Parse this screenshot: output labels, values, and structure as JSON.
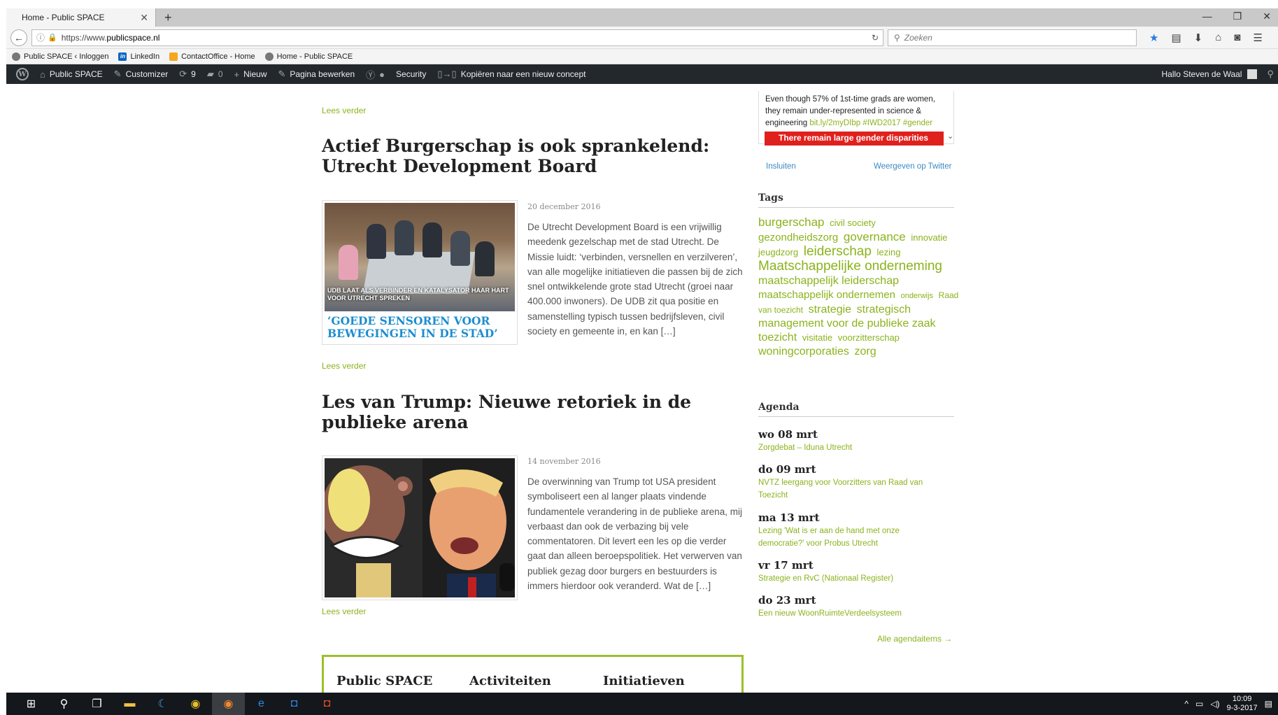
{
  "browser": {
    "tab_title": "Home - Public SPACE",
    "url_prefix": "https://www.",
    "url_host": "publicspace.nl",
    "search_placeholder": "Zoeken",
    "bookmarks": [
      "Public SPACE ‹ Inloggen",
      "LinkedIn",
      "ContactOffice - Home",
      "Home - Public SPACE"
    ]
  },
  "wpbar": {
    "site": "Public SPACE",
    "customizer": "Customizer",
    "updates": "9",
    "comments": "0",
    "new": "Nieuw",
    "edit": "Pagina bewerken",
    "security": "Security",
    "copy": "Kopiëren naar een nieuw concept",
    "greeting": "Hallo Steven de Waal"
  },
  "posts": [
    {
      "title": "Actief Burgerschap is ook sprankelend: Utrecht Development Board",
      "date": "20 december 2016",
      "excerpt": "De Utrecht Development Board is een vrijwillig meedenk gezelschap met de stad Utrecht. De Missie luidt: ‘verbinden, versnellen en verzilveren’, van alle mogelijke initiatieven die passen bij de zich snel ontwikkelende grote stad Utrecht (groei naar 400.000 inwoners). De UDB zit qua positie en samenstelling typisch tussen bedrijfsleven, civil society en gemeente in, en kan […]",
      "image_caption": "UDB LAAT ALS VERBINDER EN KATALYSATOR HAAR HART VOOR UTRECHT SPREKEN",
      "image_quote": "‘GOEDE SENSOREN VOOR BEWEGINGEN IN DE STAD’"
    },
    {
      "title": "Les van Trump: Nieuwe retoriek in de publieke arena",
      "date": "14 november 2016",
      "excerpt": "De overwinning van Trump tot USA president symboliseert een al langer plaats vindende fundamentele verandering in de publieke arena, mij verbaast dan ook de verbazing bij vele commentatoren. Dit levert een les op die verder gaat dan alleen beroepspolitiek. Het verwerven van publiek gezag door burgers en bestuurders is immers hierdoor ook veranderd. Wat de […]"
    }
  ],
  "read_more": "Lees verder",
  "footer": {
    "cols": [
      "Public SPACE",
      "Activiteiten",
      "Initiatieven"
    ]
  },
  "sidebar": {
    "tweet": {
      "text": "Even though 57% of 1st-time grads are women, they remain under-represented in science & engineering",
      "links": "bit.ly/2myDIbp #IWD2017 #gender",
      "banner": "There remain large gender disparities",
      "embed": "Insluiten",
      "view": "Weergeven op Twitter"
    },
    "tags_title": "Tags",
    "tags": [
      {
        "t": "burgerschap",
        "s": 17
      },
      {
        "t": "civil society",
        "s": 13
      },
      {
        "t": "gezondheidszorg",
        "s": 15
      },
      {
        "t": "governance",
        "s": 17
      },
      {
        "t": "innovatie",
        "s": 13
      },
      {
        "t": "jeugdzorg",
        "s": 13
      },
      {
        "t": "leiderschap",
        "s": 19
      },
      {
        "t": "lezing",
        "s": 13
      },
      {
        "t": "Maatschappelijke onderneming",
        "s": 19
      },
      {
        "t": "maatschappelijk leiderschap",
        "s": 16
      },
      {
        "t": "maatschappelijk ondernemen",
        "s": 15
      },
      {
        "t": "onderwijs",
        "s": 11
      },
      {
        "t": "Raad van toezicht",
        "s": 12
      },
      {
        "t": "strategie",
        "s": 16
      },
      {
        "t": "strategisch management voor de publieke zaak",
        "s": 16
      },
      {
        "t": "toezicht",
        "s": 16
      },
      {
        "t": "visitatie",
        "s": 13
      },
      {
        "t": "voorzitterschap",
        "s": 13
      },
      {
        "t": "woningcorporaties",
        "s": 16
      },
      {
        "t": "zorg",
        "s": 16
      }
    ],
    "agenda_title": "Agenda",
    "agenda": [
      {
        "date": "wo 08 mrt",
        "title": "Zorgdebat – Iduna Utrecht"
      },
      {
        "date": "do 09 mrt",
        "title": "NVTZ leergang voor Voorzitters van Raad van Toezicht"
      },
      {
        "date": "ma 13 mrt",
        "title": "Lezing 'Wat is er aan de hand met onze democratie?' voor Probus Utrecht"
      },
      {
        "date": "vr 17 mrt",
        "title": "Strategie en RvC (Nationaal Register)"
      },
      {
        "date": "do 23 mrt",
        "title": "Een nieuw WoonRuimteVerdeelsysteem"
      }
    ],
    "all_agenda": "Alle agendaitems →"
  },
  "taskbar": {
    "time": "10:09",
    "date": "9-3-2017"
  },
  "colors": {
    "accent": "#8bb31d",
    "adminbar": "#23282d",
    "footer_border": "#9bc02a"
  }
}
